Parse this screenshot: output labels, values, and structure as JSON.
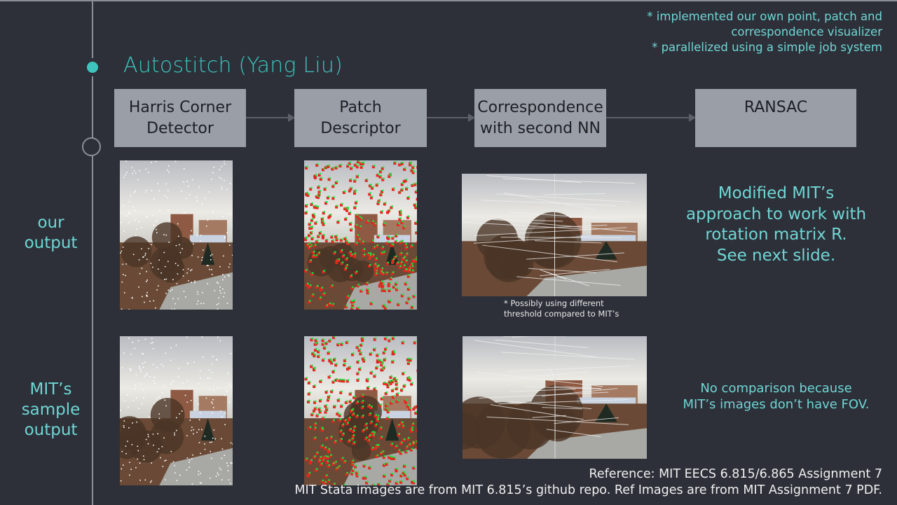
{
  "slide": {
    "title": "Autostitch (Yang Liu)",
    "notes": [
      "* implemented our own point, patch and",
      "correspondence visualizer",
      "* parallelized using a simple job system"
    ],
    "pipeline": [
      {
        "line1": "Harris Corner",
        "line2": "Detector"
      },
      {
        "line1": "Patch",
        "line2": "Descriptor"
      },
      {
        "line1": "Correspondence",
        "line2": "with second NN"
      },
      {
        "line1": "RANSAC",
        "line2": ""
      }
    ],
    "row_labels": {
      "our": [
        "our",
        "output"
      ],
      "mit": [
        "MIT’s",
        "sample",
        "output"
      ]
    },
    "images": {
      "our_harris": "our Harris corners on Stata image (white points)",
      "our_patch": "our patch descriptors (red/green patches)",
      "our_corr": "our correspondence visualization (stitched pair with lines)",
      "mit_harris": "MIT Harris corners sample",
      "mit_patch": "MIT patch descriptors sample",
      "mit_corr": "MIT correspondence sample"
    },
    "corr_caption": [
      "* Possibly using different",
      "threshold compared to MIT’s"
    ],
    "side_note_our": [
      "Modified MIT’s",
      "approach to work with",
      "rotation matrix R.",
      "See next slide."
    ],
    "side_note_mit": [
      "No comparison because",
      "MIT’s images don’t have FOV."
    ],
    "reference": "Reference: MIT EECS 6.815/6.865 Assignment 7",
    "credits": "MIT Stata images are from MIT 6.815’s github repo. Ref Images are from MIT Assignment 7 PDF."
  },
  "colors": {
    "background": "#2d3039",
    "accent": "#3ec4bc",
    "text_teal": "#6fd6d4",
    "box_fill": "#9a9ea7",
    "timeline": "#8a8e96"
  }
}
